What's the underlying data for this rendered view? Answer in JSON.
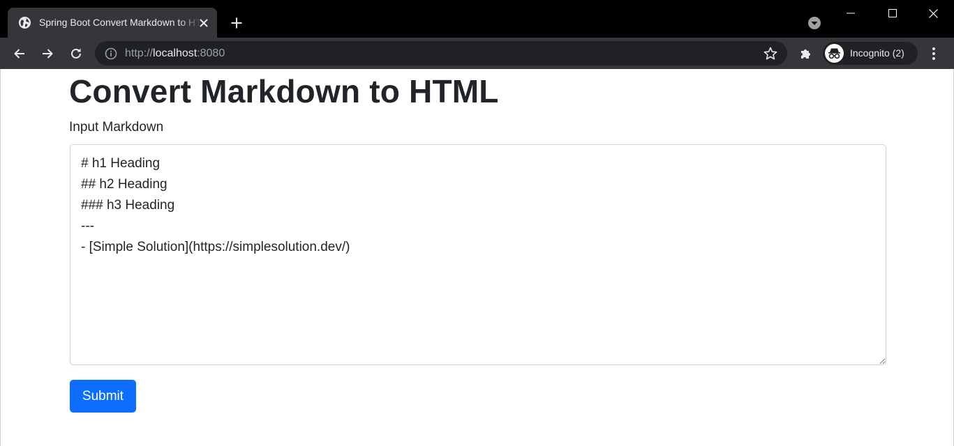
{
  "browser": {
    "tab": {
      "title": "Spring Boot Convert Markdown to HTML",
      "favicon": "globe-icon",
      "close_icon": "close-icon"
    },
    "new_tab_icon": "plus-icon",
    "tab_search_icon": "chevron-down-icon",
    "address": {
      "scheme": "http://",
      "host": "localhost",
      "port": ":8080",
      "info_icon": "info-icon",
      "bookmark_icon": "star-icon"
    },
    "profile": {
      "label": "Incognito (2)",
      "icon": "incognito-icon"
    },
    "colors": {
      "titlebar": "#000000",
      "toolbar": "#35363a",
      "omnibox": "#202124"
    }
  },
  "page": {
    "title": "Convert Markdown to HTML",
    "input_label": "Input Markdown",
    "markdown_value": "# h1 Heading\n## h2 Heading\n### h3 Heading\n---\n- [Simple Solution](https://simplesolution.dev/)",
    "submit_label": "Submit",
    "colors": {
      "primary": "#0d6efd",
      "text": "#212529"
    }
  }
}
